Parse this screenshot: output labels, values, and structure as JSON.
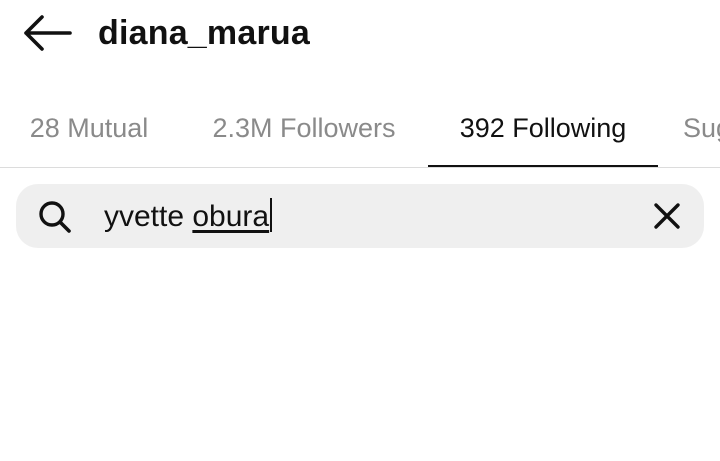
{
  "header": {
    "back_icon": "arrow-left-icon",
    "title": "diana_marua"
  },
  "tabs": [
    {
      "label": "28 Mutual",
      "active": false
    },
    {
      "label": "2.3M Followers",
      "active": false
    },
    {
      "label": "392 Following",
      "active": true
    },
    {
      "label": "Sug",
      "active": false
    }
  ],
  "search": {
    "icon": "search-icon",
    "query_part1": "yvette ",
    "query_part2": "obura",
    "clear_icon": "close-icon"
  },
  "colors": {
    "text_primary": "#111111",
    "text_secondary": "#8a8a8a",
    "search_bg": "#efefef",
    "divider": "#dcdcdc"
  }
}
